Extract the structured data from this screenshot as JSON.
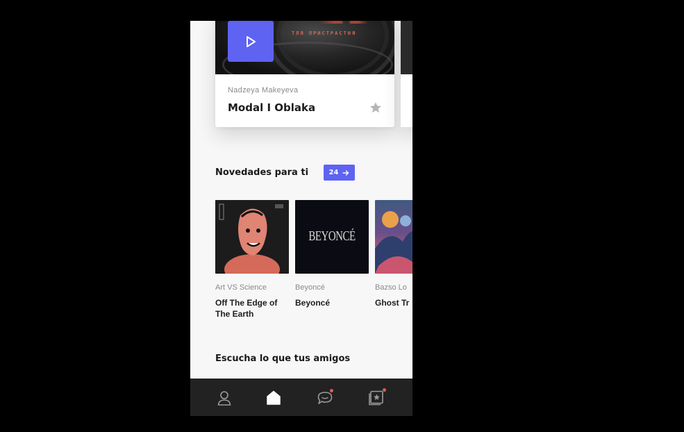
{
  "featured": {
    "artist": "Nadzeya Makeyeva",
    "title": "Modal I Oblaka",
    "cover_text": "ТЛЯ ПРИСТРАСТИЯ",
    "play_icon": "play-icon",
    "star_icon": "star-icon"
  },
  "new_for_you": {
    "title": "Novedades para ti",
    "count": "24",
    "arrow_icon": "arrow-right-icon",
    "albums": [
      {
        "artist": "Art VS Science",
        "title": "Off The Edge of The Earth"
      },
      {
        "artist": "Beyoncé",
        "title": "Beyoncé",
        "cover_text": "BEYONCÉ"
      },
      {
        "artist": "Bazso Lo",
        "title": "Ghost Tr"
      }
    ]
  },
  "friends": {
    "title": "Escucha lo que tus amigos"
  },
  "nav": {
    "items": [
      "profile-icon",
      "home-icon",
      "chat-icon",
      "favorites-icon"
    ]
  },
  "colors": {
    "accent": "#5e63f2",
    "notification": "#e0604e",
    "nav_bg": "#222222"
  }
}
